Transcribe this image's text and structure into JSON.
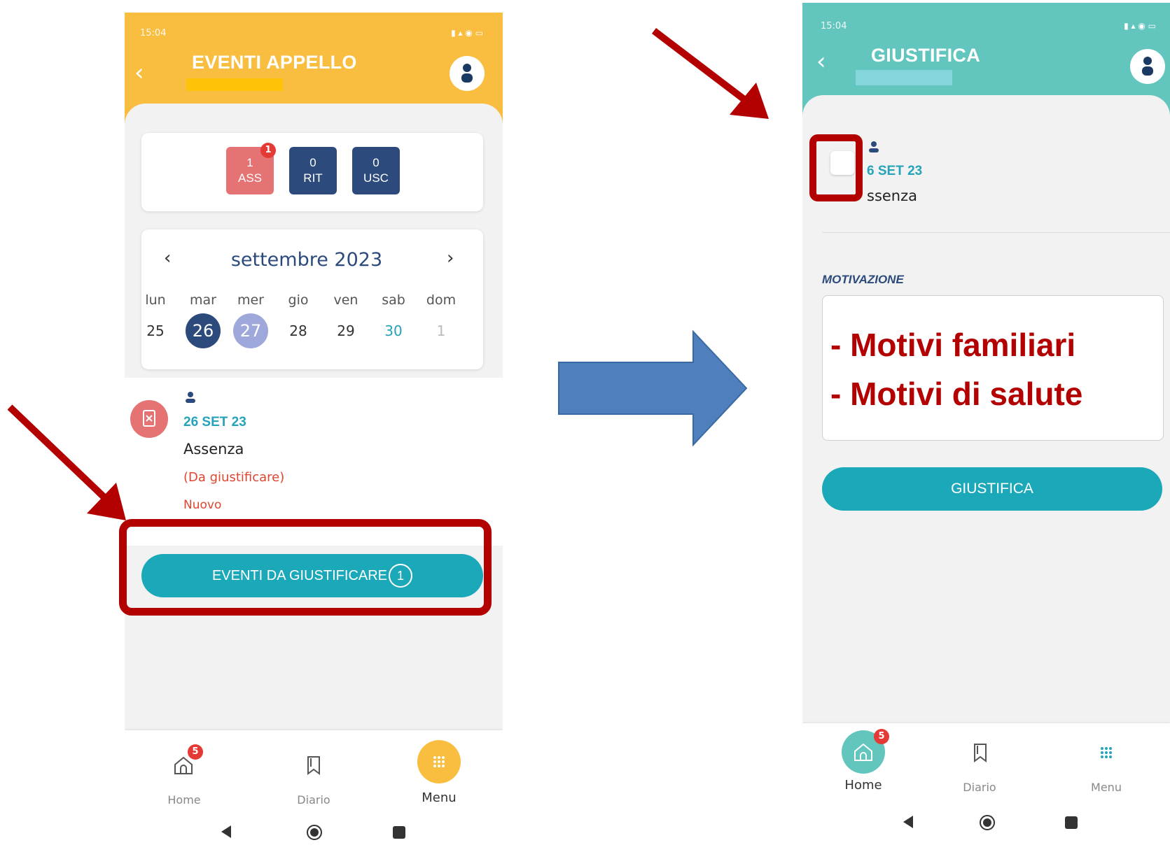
{
  "left": {
    "status": {
      "time": "15:04"
    },
    "header": {
      "title": "EVENTI APPELLO"
    },
    "counters": [
      {
        "value": "1",
        "label": "ASS",
        "badge": "1"
      },
      {
        "value": "0",
        "label": "RIT"
      },
      {
        "value": "0",
        "label": "USC"
      }
    ],
    "calendar": {
      "month": "settembre 2023",
      "day_names": [
        "lun",
        "mar",
        "mer",
        "gio",
        "ven",
        "sab",
        "dom"
      ],
      "days": [
        "25",
        "26",
        "27",
        "28",
        "29",
        "30",
        "1"
      ]
    },
    "event": {
      "date": "26 SET 23",
      "type": "Assenza",
      "status": "(Da giustificare)",
      "tag": "Nuovo"
    },
    "justify_button": {
      "label": "EVENTI DA GIUSTIFICARE",
      "count": "1"
    },
    "bottom_nav": [
      {
        "label": "Home",
        "badge": "5"
      },
      {
        "label": "Diario"
      },
      {
        "label": "Menu"
      }
    ]
  },
  "right": {
    "status": {
      "time": "15:04"
    },
    "header": {
      "title": "GIUSTIFICA"
    },
    "event": {
      "date": "6 SET 23",
      "type": "ssenza"
    },
    "motivation_label": "MOTIVAZIONE",
    "motivation_lines": [
      "- Motivi familiari",
      "- Motivi di salute"
    ],
    "justify_button": {
      "label": "GIUSTIFICA"
    },
    "bottom_nav": [
      {
        "label": "Home",
        "badge": "5"
      },
      {
        "label": "Diario"
      },
      {
        "label": "Menu"
      }
    ]
  },
  "colors": {
    "header_left": "#f9bd3f",
    "header_right": "#62c6bf",
    "counter_absence": "#e57373",
    "counter_dark": "#2d4a7c",
    "teal_button": "#1ba8b9",
    "annotation_red": "#b30000",
    "arrow_blue": "#4f80bd"
  }
}
